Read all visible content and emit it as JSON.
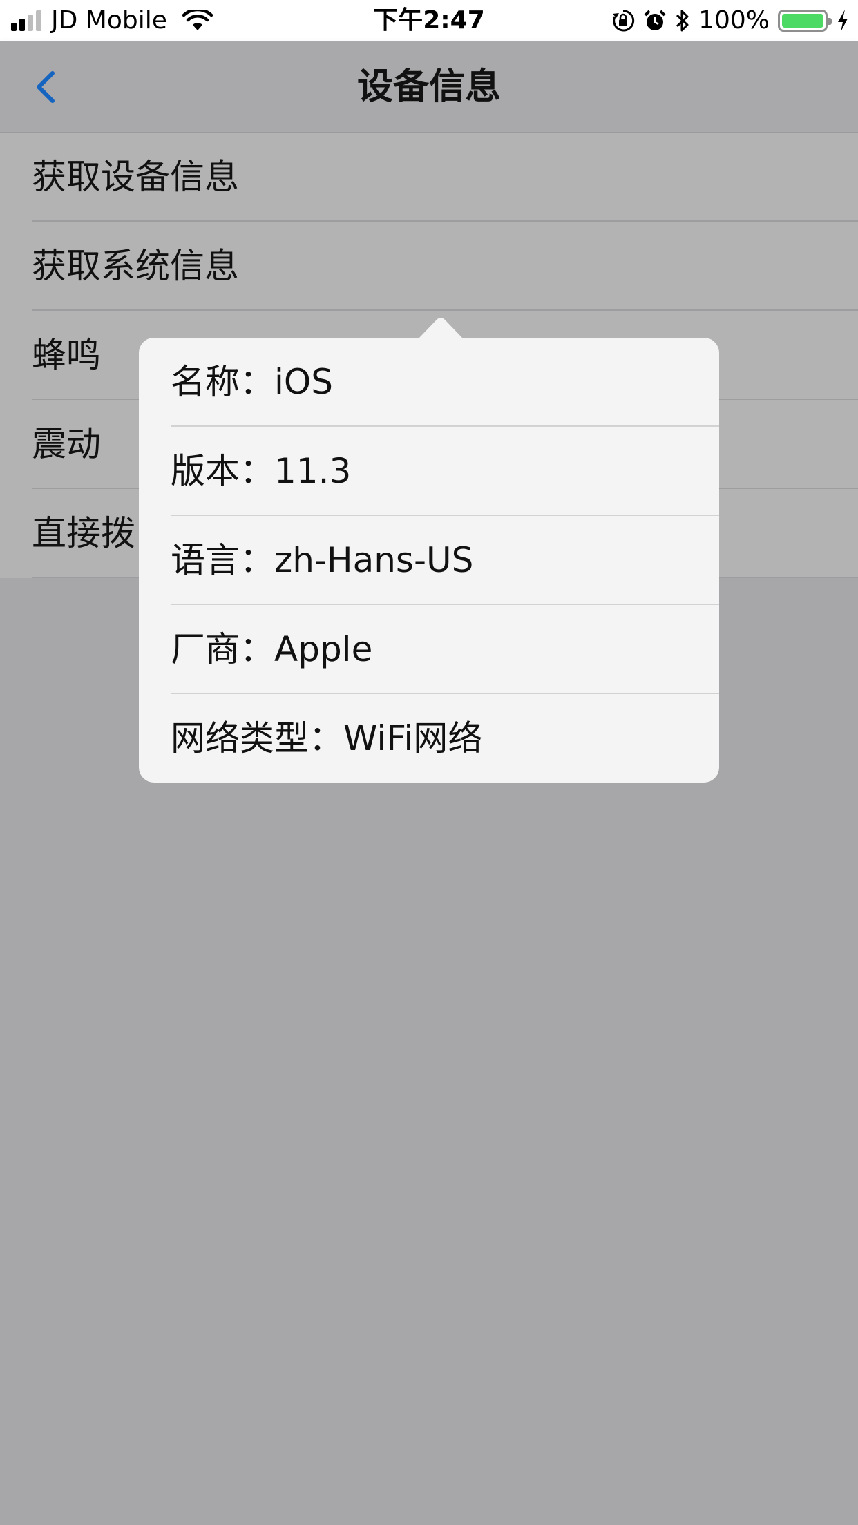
{
  "status_bar": {
    "carrier": "JD Mobile",
    "time": "下午2:47",
    "battery": "100%",
    "icons": [
      "signal-icon",
      "wifi-icon",
      "rotation-lock-icon",
      "alarm-icon",
      "bluetooth-icon",
      "battery-icon",
      "charging-icon"
    ]
  },
  "nav": {
    "title": "设备信息",
    "back_icon": "chevron-left-icon"
  },
  "list": {
    "items": [
      {
        "label": "获取设备信息"
      },
      {
        "label": "获取系统信息"
      },
      {
        "label": "蜂鸣"
      },
      {
        "label": "震动"
      },
      {
        "label": "直接拨"
      }
    ]
  },
  "popover": {
    "rows": [
      {
        "text": "名称：iOS"
      },
      {
        "text": "版本：11.3"
      },
      {
        "text": "语言：zh-Hans-US"
      },
      {
        "text": "厂商：Apple"
      },
      {
        "text": "网络类型：WiFi网络"
      }
    ]
  },
  "colors": {
    "accent": "#1565c0",
    "battery_fill": "#4cd964",
    "dim_background": "#a7a7a9",
    "popover_bg": "#f4f4f4"
  }
}
